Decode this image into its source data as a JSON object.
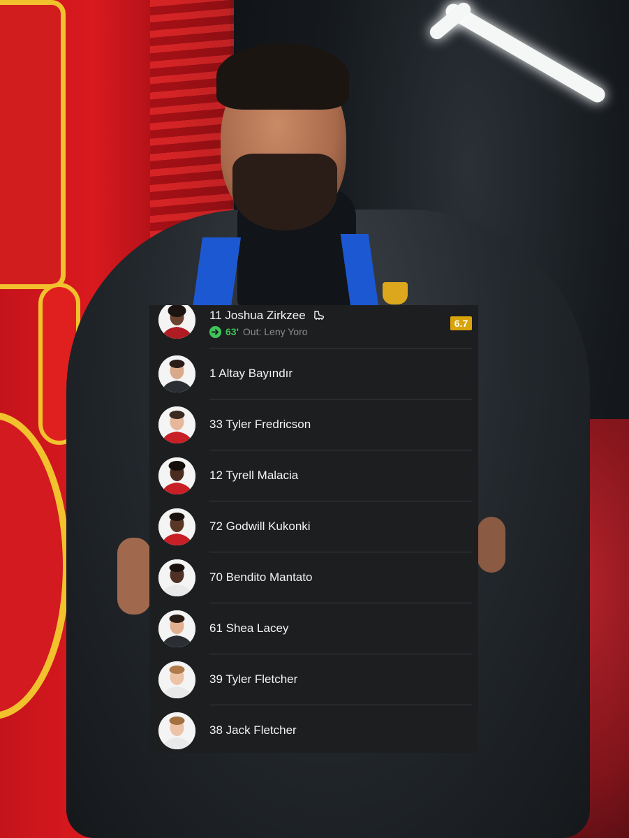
{
  "colors": {
    "panel_bg": "#1d1e20",
    "text": "#f3f3f3",
    "sub_in": "#3fc45a",
    "muted": "#8b8d90",
    "rating_bg": "#d9a40a",
    "divider": "#3a3c3f"
  },
  "bench": {
    "featured": {
      "number_name": "11 Joshua Zirkzee",
      "goal_icon": "boot-icon",
      "sub_icon": "sub-in-arrow-icon",
      "sub_minute": "63'",
      "sub_out_text": "Out: Leny Yoro",
      "rating": "6.7"
    },
    "players": [
      {
        "label": "1 Altay Bayındır"
      },
      {
        "label": "33 Tyler Fredricson"
      },
      {
        "label": "12 Tyrell Malacia"
      },
      {
        "label": "72 Godwill Kukonki"
      },
      {
        "label": "70 Bendito Mantato"
      },
      {
        "label": "61 Shea Lacey"
      },
      {
        "label": "39 Tyler Fletcher"
      },
      {
        "label": "38 Jack Fletcher"
      }
    ]
  }
}
